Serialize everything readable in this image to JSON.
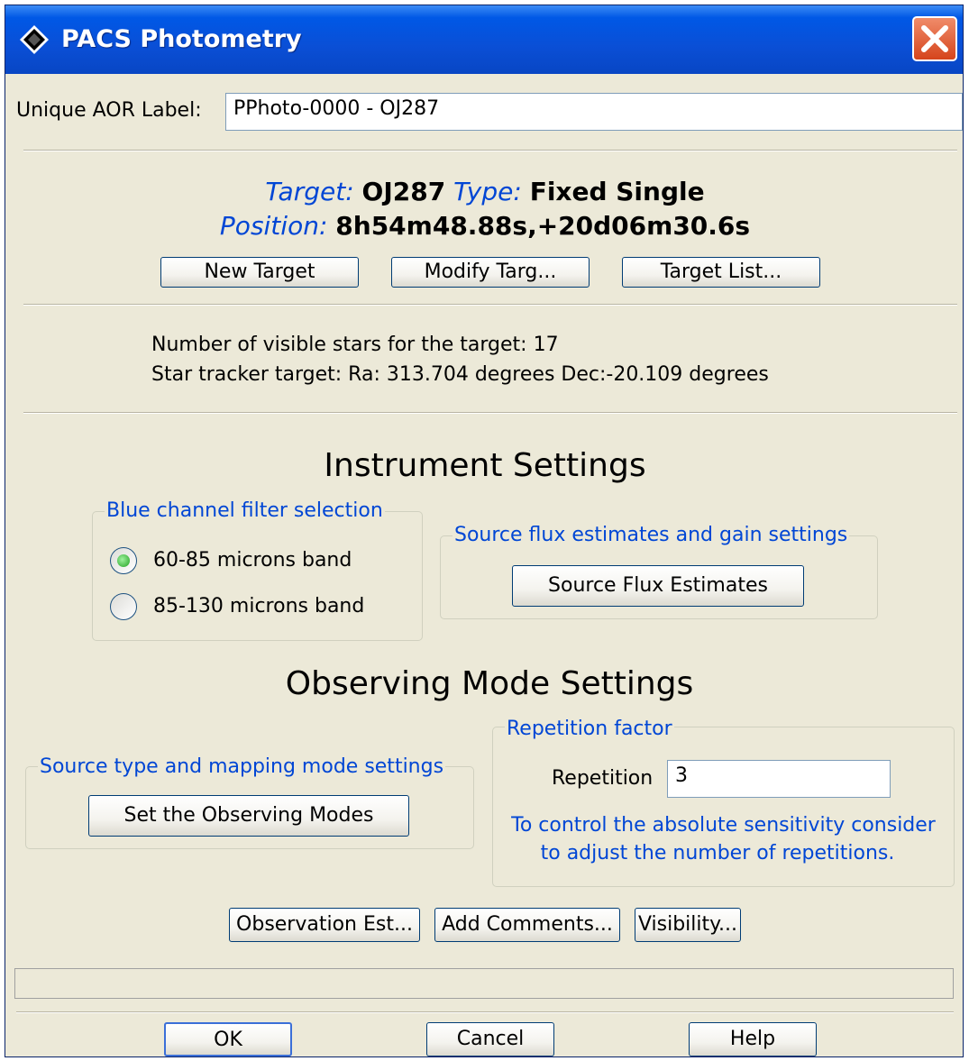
{
  "window": {
    "title": "PACS Photometry",
    "close_icon": "close-icon"
  },
  "aor": {
    "label": "Unique AOR Label:",
    "value": "PPhoto-0000 - OJ287"
  },
  "target": {
    "target_label": "Target:",
    "target_value": "OJ287",
    "type_label": "Type:",
    "type_value": "Fixed Single",
    "position_label": "Position:",
    "position_value": "8h54m48.88s,+20d06m30.6s",
    "buttons": [
      "New Target",
      "Modify Targ...",
      "Target List..."
    ]
  },
  "stars": {
    "line1": "Number of visible stars for the target: 17",
    "line2": "Star tracker target: Ra: 313.704 degrees Dec:-20.109 degrees"
  },
  "instrument": {
    "heading": "Instrument Settings",
    "filter_group": {
      "legend": "Blue channel filter selection",
      "options": [
        {
          "label": "60-85 microns band",
          "selected": true
        },
        {
          "label": "85-130 microns band",
          "selected": false
        }
      ]
    },
    "flux_group": {
      "legend": "Source flux estimates and gain settings",
      "button": "Source Flux Estimates"
    }
  },
  "observing": {
    "heading": "Observing Mode Settings",
    "mode_group": {
      "legend": "Source type and mapping mode settings",
      "button": "Set the Observing Modes"
    },
    "repetition_group": {
      "legend": "Repetition factor",
      "label": "Repetition",
      "value": "3",
      "note_line1": "To control the absolute sensitivity consider",
      "note_line2": "to adjust the number of repetitions."
    }
  },
  "actions": [
    "Observation Est...",
    "Add Comments...",
    "Visibility..."
  ],
  "footer": {
    "ok": "OK",
    "cancel": "Cancel",
    "help": "Help"
  },
  "colors": {
    "accent_blue": "#0046d5",
    "titlebar": "#0a4fd6",
    "window_bg": "#ece9d8",
    "radio_selected": "#21a121"
  }
}
